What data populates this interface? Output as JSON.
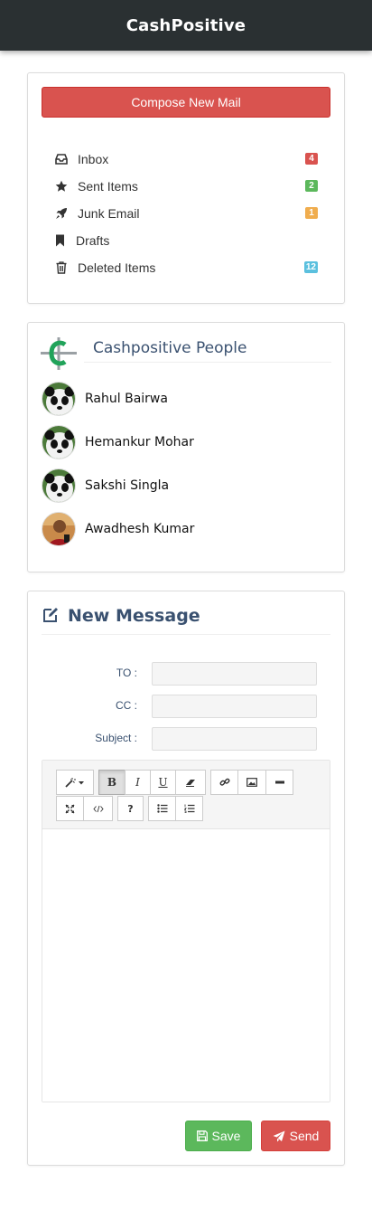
{
  "app": {
    "title": "CashPositive"
  },
  "mailbox": {
    "compose_label": "Compose New Mail",
    "folders": [
      {
        "label": "Inbox",
        "icon": "inbox-icon",
        "badge": "4",
        "badge_color": "#d9534f"
      },
      {
        "label": "Sent Items",
        "icon": "star-icon",
        "badge": "2",
        "badge_color": "#5cb85c"
      },
      {
        "label": "Junk Email",
        "icon": "rocket-icon",
        "badge": "1",
        "badge_color": "#f0ad4e"
      },
      {
        "label": "Drafts",
        "icon": "bookmark-icon",
        "badge": "",
        "badge_color": ""
      },
      {
        "label": "Deleted Items",
        "icon": "trash-icon",
        "badge": "12",
        "badge_color": "#5bc0de"
      }
    ]
  },
  "people": {
    "title": "Cashpositive People",
    "list": [
      {
        "name": "Rahul Bairwa",
        "avatar": "panda"
      },
      {
        "name": "Hemankur Mohar",
        "avatar": "panda"
      },
      {
        "name": "Sakshi Singla",
        "avatar": "panda"
      },
      {
        "name": "Awadhesh Kumar",
        "avatar": "photo"
      }
    ]
  },
  "message": {
    "title": "New Message",
    "fields": {
      "to_label": "TO :",
      "to_value": "",
      "cc_label": "CC :",
      "cc_value": "",
      "subject_label": "Subject :",
      "subject_value": ""
    },
    "toolbar": {
      "bold": "B",
      "italic": "I",
      "underline": "U",
      "help": "?"
    },
    "save_label": "Save",
    "send_label": "Send"
  },
  "colors": {
    "topbar": "#2a3032",
    "danger": "#d9534f",
    "success": "#5cb85c",
    "warning": "#f0ad4e",
    "info": "#5bc0de",
    "heading": "#3a5170"
  }
}
